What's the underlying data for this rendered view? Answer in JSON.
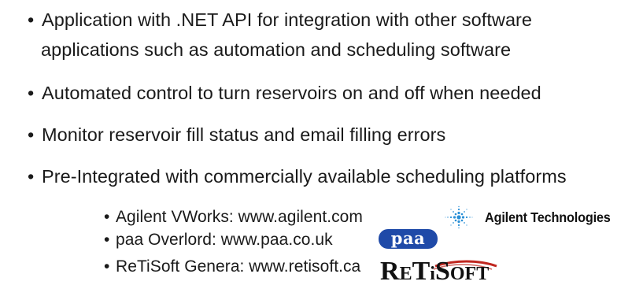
{
  "bullets": [
    "Application with .NET API for integration with other software",
    "applications such as automation and scheduling software",
    "Automated control to turn reservoirs on and off when needed",
    "Monitor reservoir fill status and email filling errors",
    "Pre-Integrated with commercially available scheduling platforms"
  ],
  "sub_bullets": [
    "Agilent VWorks: www.agilent.com",
    "paa Overlord: www.paa.co.uk",
    "ReTiSoft Genera: www.retisoft.ca"
  ],
  "bullet_glyph": "•",
  "logos": {
    "agilent": {
      "text": "Agilent Technologies",
      "icon": "agilent-spark-icon",
      "color": "#2a8fd6"
    },
    "paa": {
      "text": "paa",
      "background": "#1f4aa8"
    },
    "retisoft": {
      "text": "ReTiSoft",
      "accent": "#c0261f"
    }
  }
}
